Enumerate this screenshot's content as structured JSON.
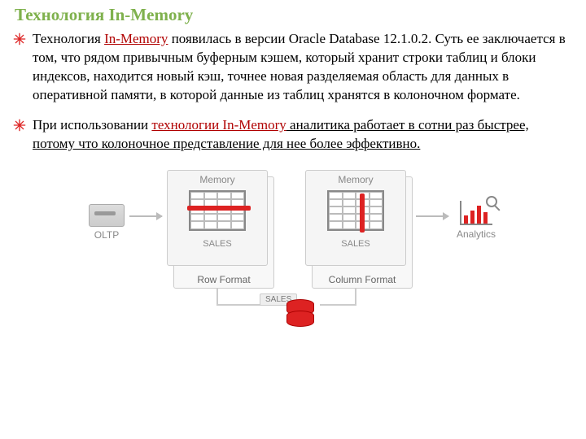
{
  "title": "Технология In-Memory",
  "bullets": [
    {
      "pre": "Технология ",
      "link": "In-Memory",
      "post": " появилась в версии Oracle Database 12.1.0.2. Суть ее заключается в том, что рядом привычным буферным кэшем, который хранит строки таблиц и блоки индексов, находится новый кэш, точнее новая разделяемая область для данных в оперативной памяти, в которой данные из таблиц хранятся в колоночном формате."
    },
    {
      "pre": "При использовании ",
      "link": "технологии In-Memory",
      "post1": " аналитика работает в сотни раз быстрее, потому что колоночное представление для нее более эффективно."
    }
  ],
  "diagram": {
    "oltp_label": "OLTP",
    "analytics_label": "Analytics",
    "memory_label": "Memory",
    "sales_label": "SALES",
    "row_format": "Row Format",
    "column_format": "Column Format"
  }
}
